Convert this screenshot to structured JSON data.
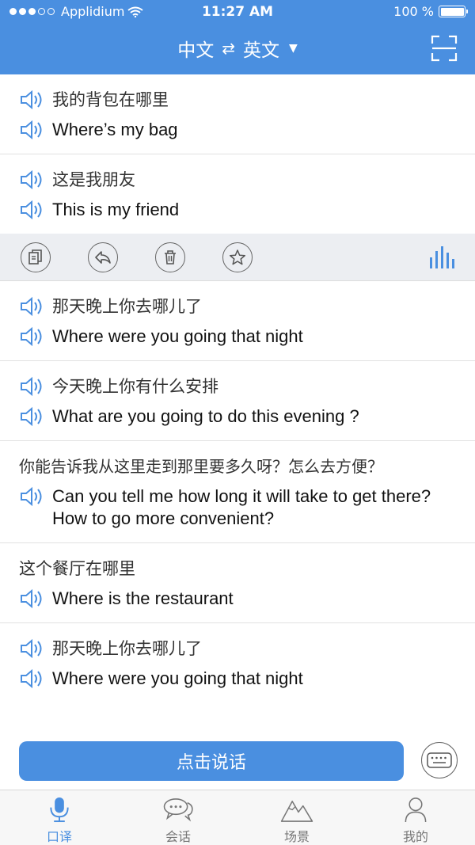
{
  "status": {
    "carrier": "Applidium",
    "time": "11:27 AM",
    "battery": "100 %"
  },
  "nav": {
    "source_lang": "中文",
    "swap_glyph": "⇄",
    "target_lang": "英文",
    "caret": "▼"
  },
  "entries": [
    {
      "zh": "我的背包在哪里",
      "en": "Where’s my bag",
      "zh_speaker": true
    },
    {
      "zh": "这是我朋友",
      "en": "This is my friend",
      "zh_speaker": true
    },
    {
      "zh": "那天晚上你去哪儿了",
      "en": "Where were you going that night",
      "zh_speaker": true
    },
    {
      "zh": "今天晚上你有什么安排",
      "en": "What are you going to do this evening ?",
      "zh_speaker": true
    },
    {
      "zh": "你能告诉我从这里走到那里要多久呀？怎么去方便？",
      "en": "Can you tell me how long it will take to get there? How to go more convenient?",
      "zh_speaker": false
    },
    {
      "zh": "这个餐厅在哪里",
      "en": "Where is the restaurant",
      "zh_speaker": false
    },
    {
      "zh": "那天晚上你去哪儿了",
      "en": "Where were you going that night",
      "zh_speaker": true
    }
  ],
  "toolbar": {
    "icons": [
      "copy-icon",
      "reply-icon",
      "trash-icon",
      "star-icon",
      "audio-bars-icon"
    ]
  },
  "input": {
    "speak_label": "点击说话"
  },
  "tabs": [
    {
      "label": "口译",
      "icon": "microphone-icon",
      "active": true
    },
    {
      "label": "会话",
      "icon": "chat-bubbles-icon",
      "active": false
    },
    {
      "label": "场景",
      "icon": "mountains-icon",
      "active": false
    },
    {
      "label": "我的",
      "icon": "person-icon",
      "active": false
    }
  ],
  "colors": {
    "brand": "#4a8fe0",
    "toolbar_bg": "#eceef2",
    "divider": "#e1e1e1"
  }
}
